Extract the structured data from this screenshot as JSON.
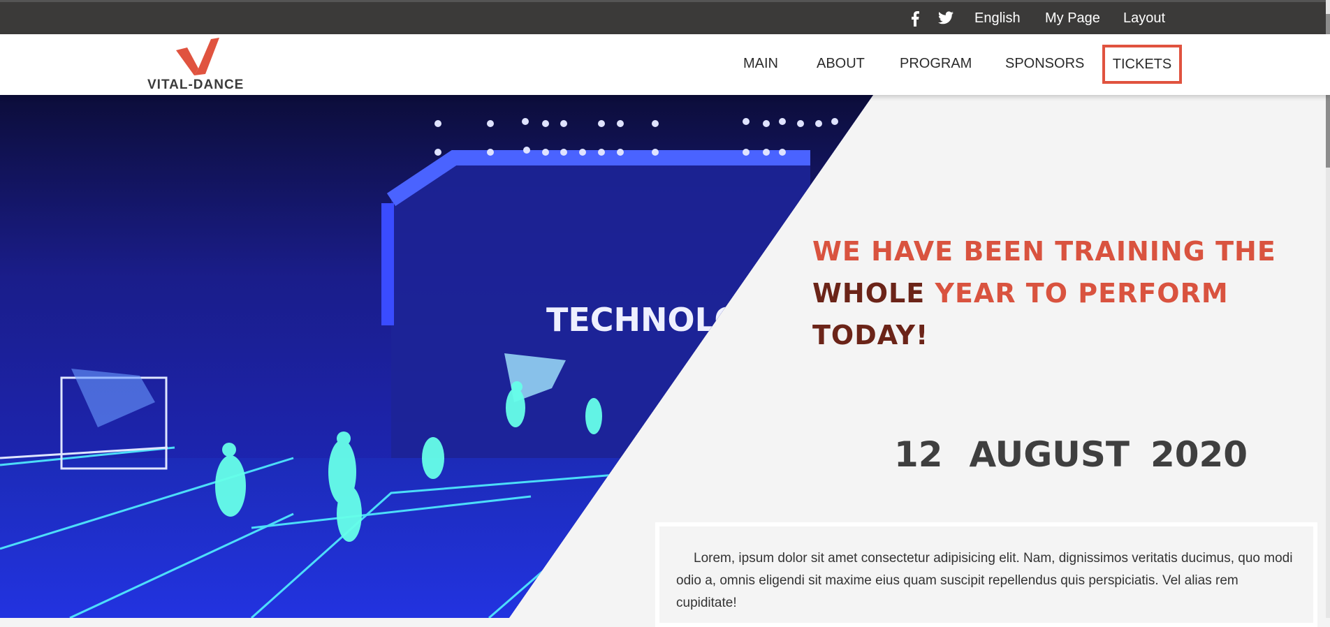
{
  "topbar": {
    "facebook_icon": "facebook-icon",
    "twitter_icon": "twitter-icon",
    "language": "English",
    "my_page": "My Page",
    "layout": "Layout"
  },
  "brand": {
    "name": "VITAL-DANCE",
    "accent": "#e0533f"
  },
  "nav": {
    "main": "MAIN",
    "about": "ABOUT",
    "program": "PROGRAM",
    "sponsors": "SPONSORS",
    "tickets": "TICKETS"
  },
  "hero": {
    "stage_sign": "TECHNOLO",
    "headline": {
      "line1": "WE HAVE BEEN TRAINING THE",
      "line2_dark": "WHOLE",
      "line2_light": "YEAR TO PERFORM",
      "line2_tail": "TODAY!"
    },
    "date": {
      "day": "12",
      "month": "AUGUST",
      "year": "2020"
    },
    "description": "Lorem, ipsum dolor sit amet consectetur adipisicing elit. Nam, dignissimos veritatis ducimus, quo modi odio a, omnis eligendi sit maxime eius quam suscipit repellendus quis perspiciatis. Vel alias rem cupiditate!"
  }
}
